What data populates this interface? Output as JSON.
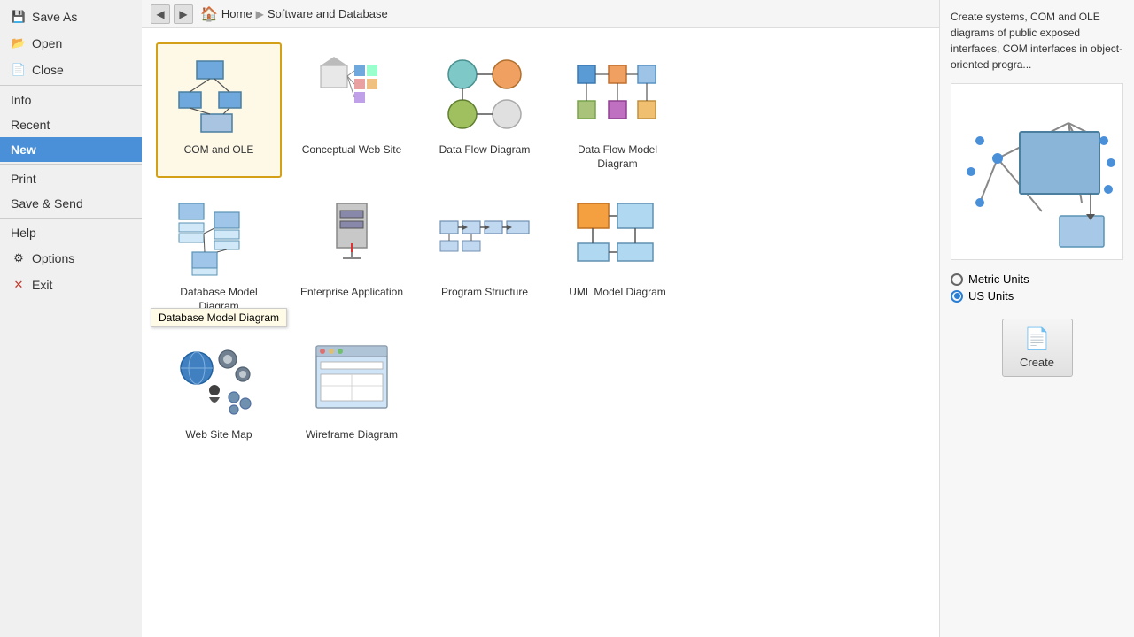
{
  "sidebar": {
    "items": [
      {
        "id": "save-as",
        "label": "Save As",
        "icon": "💾",
        "active": false
      },
      {
        "id": "open",
        "label": "Open",
        "icon": "📂",
        "active": false
      },
      {
        "id": "close",
        "label": "Close",
        "icon": "📄",
        "active": false
      },
      {
        "id": "info",
        "label": "Info",
        "icon": "",
        "active": false
      },
      {
        "id": "recent",
        "label": "Recent",
        "icon": "",
        "active": false
      },
      {
        "id": "new",
        "label": "New",
        "icon": "",
        "active": true
      },
      {
        "id": "print",
        "label": "Print",
        "icon": "",
        "active": false
      },
      {
        "id": "save-send",
        "label": "Save & Send",
        "icon": "",
        "active": false
      },
      {
        "id": "help",
        "label": "Help",
        "icon": "",
        "active": false
      },
      {
        "id": "options",
        "label": "Options",
        "icon": "⚙",
        "active": false
      },
      {
        "id": "exit",
        "label": "Exit",
        "icon": "✕",
        "active": false
      }
    ]
  },
  "breadcrumb": {
    "home": "Home",
    "separator": "▶",
    "current": "Software and Database"
  },
  "diagrams": [
    {
      "id": "com-ole",
      "label": "COM and OLE",
      "selected": true,
      "tooltip": null
    },
    {
      "id": "conceptual-web-site",
      "label": "Conceptual Web Site",
      "selected": false,
      "tooltip": null
    },
    {
      "id": "data-flow-diagram",
      "label": "Data Flow Diagram",
      "selected": false,
      "tooltip": null
    },
    {
      "id": "data-flow-model-diagram",
      "label": "Data Flow Model Diagram",
      "selected": false,
      "tooltip": null
    },
    {
      "id": "database-model-diagram",
      "label": "Database Model Diagram",
      "selected": false,
      "tooltip": "Database Model Diagram"
    },
    {
      "id": "enterprise-application",
      "label": "Enterprise Application",
      "selected": false,
      "tooltip": null
    },
    {
      "id": "program-structure",
      "label": "Program Structure",
      "selected": false,
      "tooltip": null
    },
    {
      "id": "uml-model-diagram",
      "label": "UML Model Diagram",
      "selected": false,
      "tooltip": null
    },
    {
      "id": "web-site-map",
      "label": "Web Site Map",
      "selected": false,
      "tooltip": null
    },
    {
      "id": "wireframe-diagram",
      "label": "Wireframe Diagram",
      "selected": false,
      "tooltip": null
    }
  ],
  "rightPanel": {
    "description": "Create systems, COM and OLE diagrams of public exposed interfaces, COM interfaces in object-oriented progra...",
    "units": {
      "metric": {
        "label": "Metric Units",
        "selected": false
      },
      "us": {
        "label": "US Units",
        "selected": true
      }
    },
    "createBtn": "Create"
  }
}
